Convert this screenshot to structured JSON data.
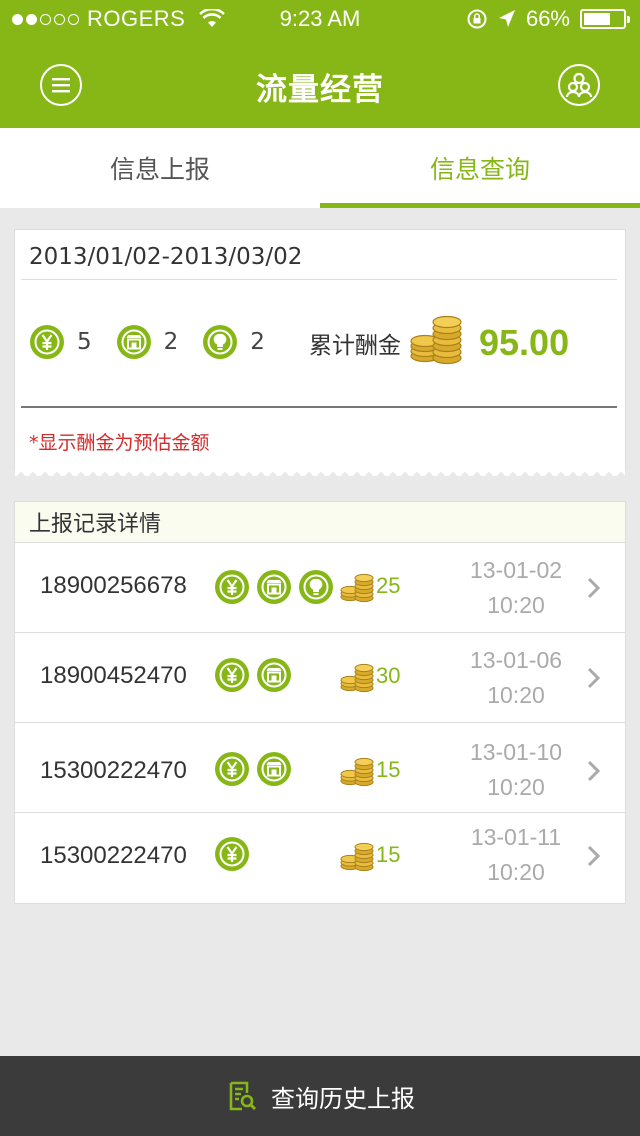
{
  "status_bar": {
    "carrier": "ROGERS",
    "time": "9:23 AM",
    "battery": "66%"
  },
  "nav": {
    "title": "流量经营",
    "menu_icon": "menu-icon",
    "user_icon": "users-icon"
  },
  "tabs": [
    {
      "label": "信息上报",
      "active": false
    },
    {
      "label": "信息查询",
      "active": true
    }
  ],
  "summary": {
    "date_range": "2013/01/02-2013/03/02",
    "stats": [
      {
        "icon": "yuan-icon",
        "count": "5"
      },
      {
        "icon": "shop-icon",
        "count": "2"
      },
      {
        "icon": "bulb-icon",
        "count": "2"
      }
    ],
    "cumulative_label": "累计酬金",
    "total": "95.00",
    "note": "*显示酬金为预估金额"
  },
  "records": {
    "title": "上报记录详情",
    "rows": [
      {
        "phone": "18900256678",
        "icons": [
          "yuan-icon",
          "shop-icon",
          "bulb-icon"
        ],
        "reward": "25",
        "date": "13-01-02",
        "time": "10:20"
      },
      {
        "phone": "18900452470",
        "icons": [
          "yuan-icon",
          "shop-icon"
        ],
        "reward": "30",
        "date": "13-01-06",
        "time": "10:20"
      },
      {
        "phone": "15300222470",
        "icons": [
          "yuan-icon",
          "shop-icon"
        ],
        "reward": "15",
        "date": "13-01-10",
        "time": "10:20"
      },
      {
        "phone": "15300222470",
        "icons": [
          "yuan-icon"
        ],
        "reward": "15",
        "date": "13-01-11",
        "time": "10:20"
      }
    ]
  },
  "bottom_button": {
    "label": "查询历史上报",
    "icon": "search-document-icon"
  },
  "colors": {
    "brand": "#86b716",
    "alert": "#d52b2b",
    "bottom_bar": "#3b3b3b"
  }
}
